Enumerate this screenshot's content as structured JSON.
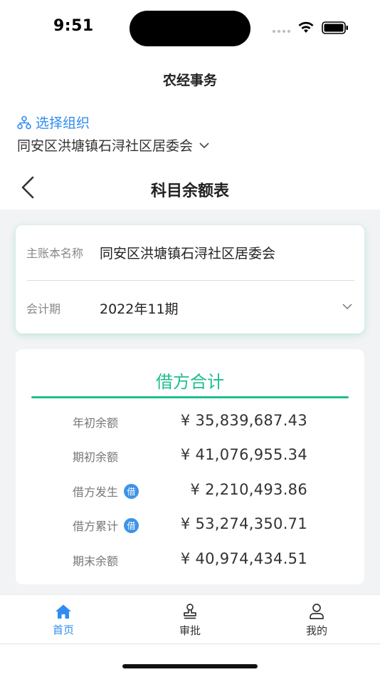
{
  "status_bar": {
    "time": "9:51"
  },
  "app": {
    "title": "农经事务"
  },
  "org": {
    "select_label": "选择组织",
    "current_name": "同安区洪塘镇石浔社区居委会"
  },
  "nav": {
    "title": "科目余额表"
  },
  "form": {
    "account_label": "主账本名称",
    "account_value": "同安区洪塘镇石浔社区居委会",
    "period_label": "会计期",
    "period_value": "2022年11期"
  },
  "summary": {
    "title": "借方合计",
    "rows": [
      {
        "label": "年初余额",
        "value": "¥ 35,839,687.43"
      },
      {
        "label": "期初余额",
        "value": "¥ 41,076,955.34"
      },
      {
        "label": "借方发生",
        "value": "¥ 2,210,493.86",
        "badge": "借"
      },
      {
        "label": "借方累计",
        "value": "¥ 53,274,350.71",
        "badge": "借"
      },
      {
        "label": "期末余额",
        "value": "¥ 40,974,434.51"
      }
    ]
  },
  "tabs": [
    {
      "label": "首页",
      "icon": "home-icon",
      "active": true
    },
    {
      "label": "审批",
      "icon": "stamp-icon",
      "active": false
    },
    {
      "label": "我的",
      "icon": "user-icon",
      "active": false
    }
  ],
  "colors": {
    "accent": "#2f8cf0",
    "green": "#1fbf8f",
    "badge": "#3e93e8",
    "background": "#f2f3f5"
  }
}
